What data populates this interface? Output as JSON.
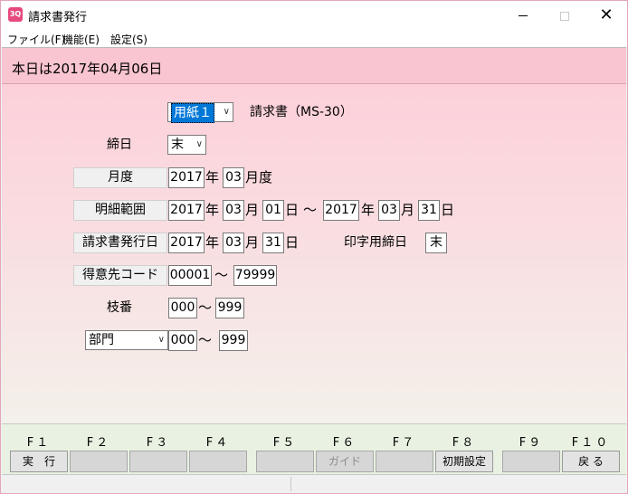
{
  "window": {
    "title": "請求書発行",
    "icon_text": "3Q"
  },
  "menu": {
    "items": [
      "ファイル(F)",
      "機能(E)",
      "設定(S)"
    ]
  },
  "header": {
    "date_text": "本日は2017年04月06日"
  },
  "form": {
    "paper": {
      "value": "用紙１",
      "type_label": "請求書（MS-30）"
    },
    "closing_day": {
      "label": "締日",
      "value": "末"
    },
    "month": {
      "label": "月度",
      "year": "2017",
      "year_unit": "年",
      "month": "03",
      "suffix": "月度"
    },
    "detail_range": {
      "label": "明細範囲",
      "from_year": "2017",
      "from_month": "03",
      "from_day": "01",
      "to_year": "2017",
      "to_month": "03",
      "to_day": "31",
      "year_unit": "年",
      "month_unit": "月",
      "day_unit": "日",
      "tilde": "～"
    },
    "issue_date": {
      "label": "請求書発行日",
      "year": "2017",
      "month": "03",
      "day": "31",
      "print_closing_label": "印字用締日",
      "print_closing_value": "末"
    },
    "customer_code": {
      "label": "得意先コード",
      "from": "00001",
      "to": "79999",
      "tilde": "～"
    },
    "branch": {
      "label": "枝番",
      "from": "000",
      "to": "999",
      "tilde": "～"
    },
    "department": {
      "value": "部門",
      "from": "000",
      "to": "999",
      "tilde": "～"
    }
  },
  "fkeys": [
    {
      "key": "F１",
      "label": "実　行"
    },
    {
      "key": "F２",
      "label": ""
    },
    {
      "key": "F３",
      "label": ""
    },
    {
      "key": "F４",
      "label": ""
    },
    {
      "key": "F５",
      "label": ""
    },
    {
      "key": "F６",
      "label": "ガイド"
    },
    {
      "key": "F７",
      "label": ""
    },
    {
      "key": "F８",
      "label": "初期設定"
    },
    {
      "key": "F９",
      "label": ""
    },
    {
      "key": "F１０",
      "label": "戻 る"
    }
  ]
}
